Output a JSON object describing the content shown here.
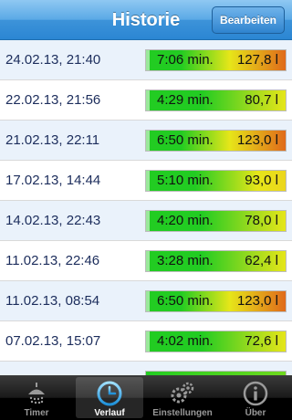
{
  "nav": {
    "title": "Historie",
    "edit_label": "Bearbeiten"
  },
  "rows": [
    {
      "date": "24.02.13, 21:40",
      "time": "7:06 min.",
      "volume": "127,8 l",
      "level": 0.95
    },
    {
      "date": "22.02.13, 21:56",
      "time": "4:29 min.",
      "volume": "80,7 l",
      "level": 0.55
    },
    {
      "date": "21.02.13, 22:11",
      "time": "6:50 min.",
      "volume": "123,0 l",
      "level": 0.92
    },
    {
      "date": "17.02.13, 14:44",
      "time": "5:10 min.",
      "volume": "93,0 l",
      "level": 0.68
    },
    {
      "date": "14.02.13, 22:43",
      "time": "4:20 min.",
      "volume": "78,0 l",
      "level": 0.55
    },
    {
      "date": "11.02.13, 22:46",
      "time": "3:28 min.",
      "volume": "62,4 l",
      "level": 0.45
    },
    {
      "date": "11.02.13, 08:54",
      "time": "6:50 min.",
      "volume": "123,0 l",
      "level": 0.92
    },
    {
      "date": "07.02.13, 15:07",
      "time": "4:02 min.",
      "volume": "72,6 l",
      "level": 0.52
    }
  ],
  "tabs": [
    {
      "label": "Timer",
      "icon": "shower-icon"
    },
    {
      "label": "Verlauf",
      "icon": "clock-icon"
    },
    {
      "label": "Einstellungen",
      "icon": "gears-icon"
    },
    {
      "label": "Über",
      "icon": "info-icon"
    }
  ],
  "active_tab": 1,
  "colors": {
    "bar_green": "#22cc22",
    "bar_yellow": "#e6e619",
    "bar_red": "#e06a1a",
    "row_alt": "#eaf2fb"
  }
}
